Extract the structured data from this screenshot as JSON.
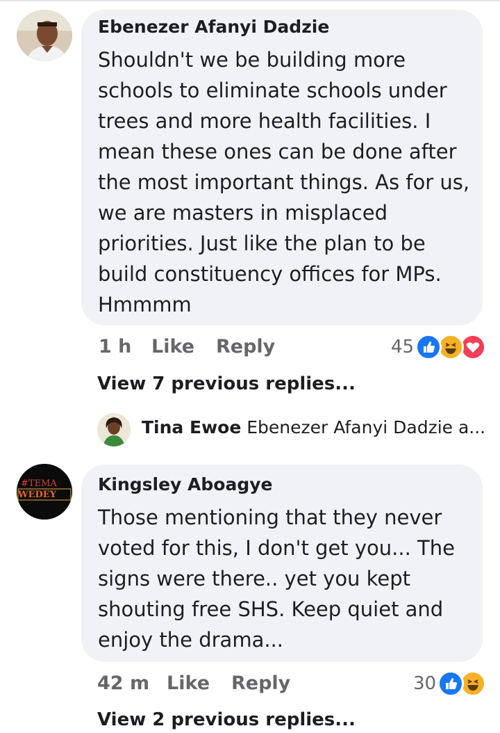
{
  "comments": [
    {
      "author": "Ebenezer Afanyi Dadzie",
      "text": "Shouldn't we be building more schools to eliminate schools under trees and more health facilities. I mean these ones can be done after the most important things. As for us, we are masters in misplaced priorities. Just like the plan to be build constituency offices for MPs. Hmmmm",
      "time": "1 h",
      "like_label": "Like",
      "reply_label": "Reply",
      "reaction_count": "45",
      "reactions": [
        "like-icon",
        "haha-icon",
        "love-icon"
      ],
      "view_replies": "View 7 previous replies...",
      "reply_preview": {
        "author": "Tina Ewoe",
        "text": "Ebenezer Afanyi Dadzie a..."
      }
    },
    {
      "author": "Kingsley Aboagye",
      "avatar_text": "TEMA WEDEY",
      "text": "Those mentioning that they never voted for this, I don't get you... The signs were there..  yet you kept shouting free SHS. Keep quiet and enjoy the drama...",
      "time": "42 m",
      "like_label": "Like",
      "reply_label": "Reply",
      "reaction_count": "30",
      "reactions": [
        "like-icon",
        "haha-icon"
      ],
      "view_replies": "View 2 previous replies..."
    }
  ],
  "colors": {
    "bubble": "#f0f2f5",
    "meta": "#65676b",
    "like": "#1877f2",
    "haha": "#f7b125",
    "love": "#f33e58"
  }
}
